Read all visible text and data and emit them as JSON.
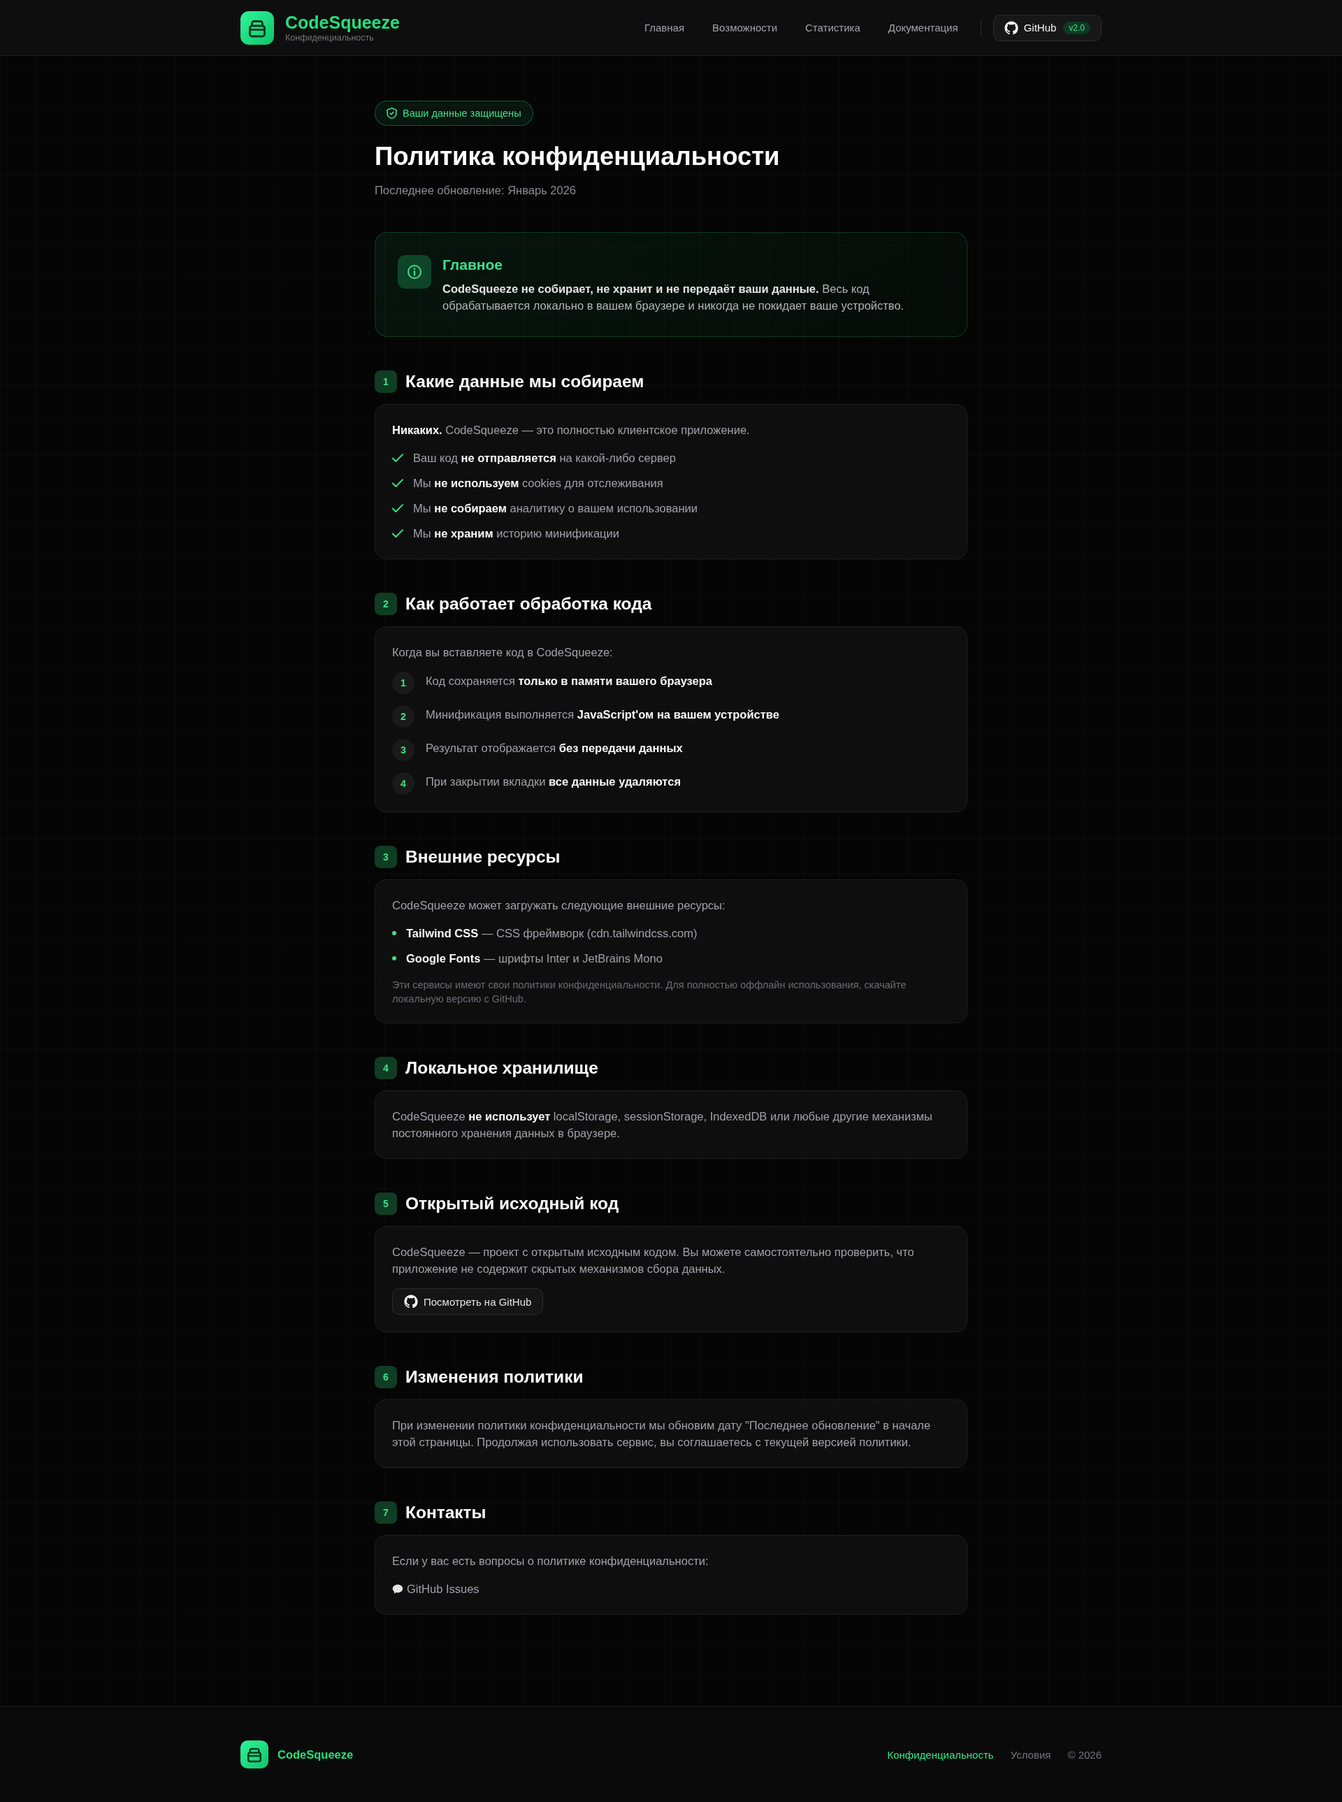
{
  "header": {
    "logo_title": "CodeSqueeze",
    "logo_subtitle": "Конфиденциальность",
    "nav": [
      {
        "label": "Главная"
      },
      {
        "label": "Возможности"
      },
      {
        "label": "Статистика"
      },
      {
        "label": "Документация"
      }
    ],
    "github_button": {
      "label": "GitHub",
      "version": "v2.0"
    }
  },
  "hero": {
    "badge": "Ваши данные защищены",
    "title": "Политика конфиденциальности",
    "updated": "Последнее обновление: Январь 2026"
  },
  "summary": {
    "title": "Главное",
    "text": "**CodeSqueeze не собирает, не хранит и не передаёт ваши данные.** Весь код обрабатывается локально в вашем браузере и никогда не покидает ваше устройство."
  },
  "sections": [
    {
      "number": "1",
      "title": "Какие данные мы собираем",
      "blocks": [
        {
          "kind": "paragraph",
          "text": "**Никаких.** CodeSqueeze — это полностью клиентское приложение."
        },
        {
          "kind": "checklist",
          "items": [
            "Ваш код **не отправляется** на какой-либо сервер",
            "Мы **не используем** cookies для отслеживания",
            "Мы **не собираем** аналитику о вашем использовании",
            "Мы **не храним** историю минификации"
          ]
        }
      ]
    },
    {
      "number": "2",
      "title": "Как работает обработка кода",
      "blocks": [
        {
          "kind": "paragraph",
          "text": "Когда вы вставляете код в CodeSqueeze:"
        },
        {
          "kind": "steps",
          "items": [
            {
              "number": "1",
              "text": "Код сохраняется **только в памяти вашего браузера**"
            },
            {
              "number": "2",
              "text": "Минификация выполняется **JavaScript'ом на вашем устройстве**"
            },
            {
              "number": "3",
              "text": "Результат отображается **без передачи данных**"
            },
            {
              "number": "4",
              "text": "При закрытии вкладки **все данные удаляются**"
            }
          ]
        }
      ]
    },
    {
      "number": "3",
      "title": "Внешние ресурсы",
      "blocks": [
        {
          "kind": "paragraph",
          "text": "CodeSqueeze может загружать следующие внешние ресурсы:"
        },
        {
          "kind": "bullets",
          "items": [
            "**Tailwind CSS** — CSS фреймворк (cdn.tailwindcss.com)",
            "**Google Fonts** — шрифты Inter и JetBrains Mono"
          ]
        },
        {
          "kind": "note",
          "text": "Эти сервисы имеют свои политики конфиденциальности. Для полностью оффлайн использования, скачайте локальную версию с GitHub."
        }
      ]
    },
    {
      "number": "4",
      "title": "Локальное хранилище",
      "blocks": [
        {
          "kind": "paragraph",
          "text": "CodeSqueeze **не использует** localStorage, sessionStorage, IndexedDB или любые другие механизмы постоянного хранения данных в браузере."
        }
      ]
    },
    {
      "number": "5",
      "title": "Открытый исходный код",
      "blocks": [
        {
          "kind": "paragraph",
          "text": "CodeSqueeze — проект с открытым исходным кодом. Вы можете самостоятельно проверить, что приложение не содержит скрытых механизмов сбора данных."
        },
        {
          "kind": "button",
          "label": "Посмотреть на GitHub"
        }
      ]
    },
    {
      "number": "6",
      "title": "Изменения политики",
      "blocks": [
        {
          "kind": "paragraph",
          "text": "При изменении политики конфиденциальности мы обновим дату \"Последнее обновление\" в начале этой страницы. Продолжая использовать сервис, вы соглашаетесь с текущей версией политики."
        }
      ]
    },
    {
      "number": "7",
      "title": "Контакты",
      "blocks": [
        {
          "kind": "paragraph",
          "text": "Если у вас есть вопросы о политике конфиденциальности:"
        },
        {
          "kind": "link",
          "label": "GitHub Issues"
        }
      ]
    }
  ],
  "footer": {
    "logo_title": "CodeSqueeze",
    "links": [
      {
        "label": "Конфиденциальность",
        "selected": true
      },
      {
        "label": "Условия",
        "selected": false
      }
    ],
    "copyright": "© 2026"
  }
}
